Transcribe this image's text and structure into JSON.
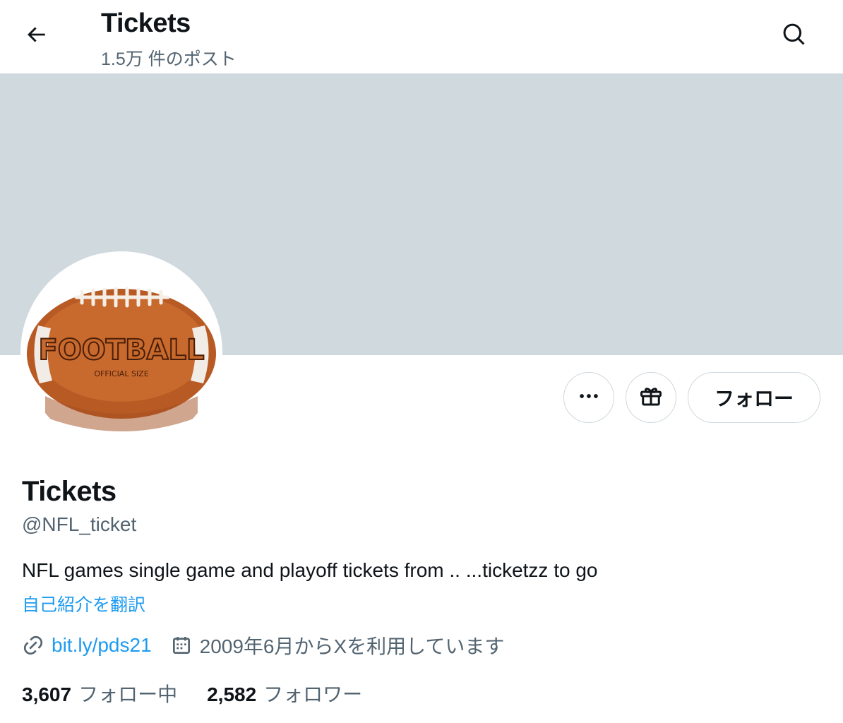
{
  "header": {
    "title": "Tickets",
    "post_count": "1.5万 件のポスト",
    "back_icon": "arrow-left-icon",
    "search_icon": "search-icon"
  },
  "banner": {
    "color": "#cfd9de"
  },
  "avatar": {
    "text": "FOOTBALL",
    "subtext": "OFFICIAL SIZE"
  },
  "actions": {
    "more_icon": "more-icon",
    "gift_icon": "gift-icon",
    "follow_label": "フォロー"
  },
  "profile": {
    "display_name": "Tickets",
    "handle": "@NFL_ticket",
    "bio": "NFL games single game and playoff tickets from .. ...ticketzz to go",
    "translate_label": "自己紹介を翻訳",
    "link_text": "bit.ly/pds21",
    "joined": "2009年6月からXを利用しています"
  },
  "stats": {
    "following_count": "3,607",
    "following_label": "フォロー中",
    "followers_count": "2,582",
    "followers_label": "フォロワー"
  },
  "colors": {
    "accent": "#1d9bf0",
    "secondary_text": "#536471",
    "border": "#cfd9de"
  }
}
